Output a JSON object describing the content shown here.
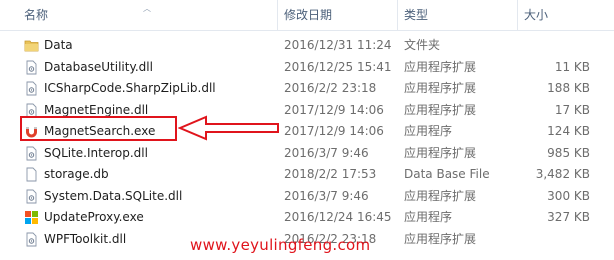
{
  "columns": {
    "name": "名称",
    "date": "修改日期",
    "type": "类型",
    "size": "大小"
  },
  "files": [
    {
      "name": "Data",
      "date": "2016/12/31 11:24",
      "type": "文件夹",
      "size": "",
      "icon": "folder-icon"
    },
    {
      "name": "DatabaseUtility.dll",
      "date": "2016/12/25 15:41",
      "type": "应用程序扩展",
      "size": "11 KB",
      "icon": "dll-file-icon"
    },
    {
      "name": "ICSharpCode.SharpZipLib.dll",
      "date": "2016/2/2 23:18",
      "type": "应用程序扩展",
      "size": "188 KB",
      "icon": "dll-file-icon"
    },
    {
      "name": "MagnetEngine.dll",
      "date": "2017/12/9 14:06",
      "type": "应用程序扩展",
      "size": "17 KB",
      "icon": "dll-file-icon"
    },
    {
      "name": "MagnetSearch.exe",
      "date": "2017/12/9 14:06",
      "type": "应用程序",
      "size": "124 KB",
      "icon": "magnet-app-icon"
    },
    {
      "name": "SQLite.Interop.dll",
      "date": "2016/3/7 9:46",
      "type": "应用程序扩展",
      "size": "985 KB",
      "icon": "dll-file-icon"
    },
    {
      "name": "storage.db",
      "date": "2018/2/2 17:53",
      "type": "Data Base File",
      "size": "3,482 KB",
      "icon": "db-file-icon"
    },
    {
      "name": "System.Data.SQLite.dll",
      "date": "2016/3/7 9:46",
      "type": "应用程序扩展",
      "size": "300 KB",
      "icon": "dll-file-icon"
    },
    {
      "name": "UpdateProxy.exe",
      "date": "2016/12/24 16:45",
      "type": "应用程序",
      "size": "327 KB",
      "icon": "exe-app-icon"
    },
    {
      "name": "WPFToolkit.dll",
      "date": "2016/2/2 23:18",
      "type": "应用程序扩展",
      "size": "",
      "icon": "dll-file-icon"
    }
  ],
  "watermark": "www.yeyulingfeng.com",
  "colors": {
    "highlight": "#e0141c",
    "header_text": "#4c607a",
    "folder": "#e8c25a"
  }
}
